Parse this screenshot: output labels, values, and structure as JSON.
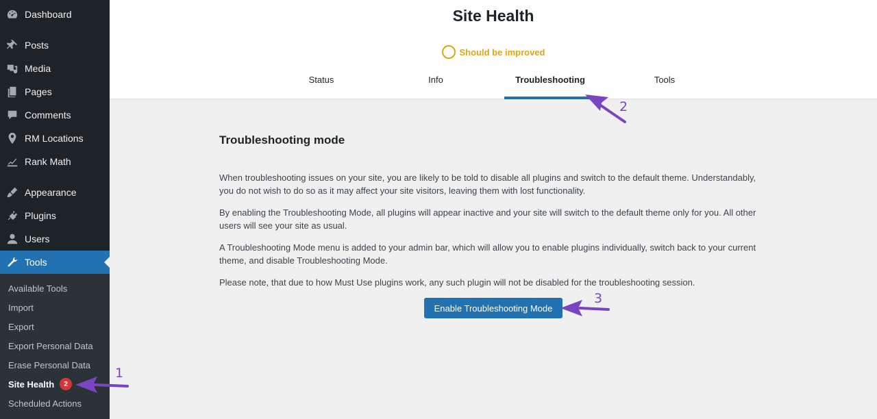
{
  "sidebar": {
    "items": [
      {
        "label": "Dashboard",
        "icon": "dashboard-icon"
      },
      {
        "label": "Posts",
        "icon": "pin-icon"
      },
      {
        "label": "Media",
        "icon": "media-icon"
      },
      {
        "label": "Pages",
        "icon": "pages-icon"
      },
      {
        "label": "Comments",
        "icon": "comments-icon"
      },
      {
        "label": "RM Locations",
        "icon": "location-icon"
      },
      {
        "label": "Rank Math",
        "icon": "rank-math-icon"
      },
      {
        "label": "Appearance",
        "icon": "brush-icon"
      },
      {
        "label": "Plugins",
        "icon": "plugins-icon"
      },
      {
        "label": "Users",
        "icon": "users-icon"
      },
      {
        "label": "Tools",
        "icon": "wrench-icon"
      }
    ],
    "submenu": [
      {
        "label": "Available Tools"
      },
      {
        "label": "Import"
      },
      {
        "label": "Export"
      },
      {
        "label": "Export Personal Data"
      },
      {
        "label": "Erase Personal Data"
      },
      {
        "label": "Site Health",
        "badge": "2"
      },
      {
        "label": "Scheduled Actions"
      }
    ]
  },
  "header": {
    "title": "Site Health",
    "status": "Should be improved",
    "tabs": [
      {
        "label": "Status"
      },
      {
        "label": "Info"
      },
      {
        "label": "Troubleshooting"
      },
      {
        "label": "Tools"
      }
    ]
  },
  "main": {
    "section_title": "Troubleshooting mode",
    "paragraphs": [
      "When troubleshooting issues on your site, you are likely to be told to disable all plugins and switch to the default theme. Understandably, you do not wish to do so as it may affect your site visitors, leaving them with lost functionality.",
      "By enabling the Troubleshooting Mode, all plugins will appear inactive and your site will switch to the default theme only for you. All other users will see your site as usual.",
      "A Troubleshooting Mode menu is added to your admin bar, which will allow you to enable plugins individually, switch back to your current theme, and disable Troubleshooting Mode.",
      "Please note, that due to how Must Use plugins work, any such plugin will not be disabled for the troubleshooting session."
    ],
    "button_label": "Enable Troubleshooting Mode"
  },
  "annotations": {
    "steps": [
      "1",
      "2",
      "3"
    ],
    "color": "#7b45c2"
  },
  "colors": {
    "accent": "#2271b1",
    "sidebar_bg": "#1d2327",
    "status_warning": "#dba617",
    "badge": "#d63638"
  }
}
